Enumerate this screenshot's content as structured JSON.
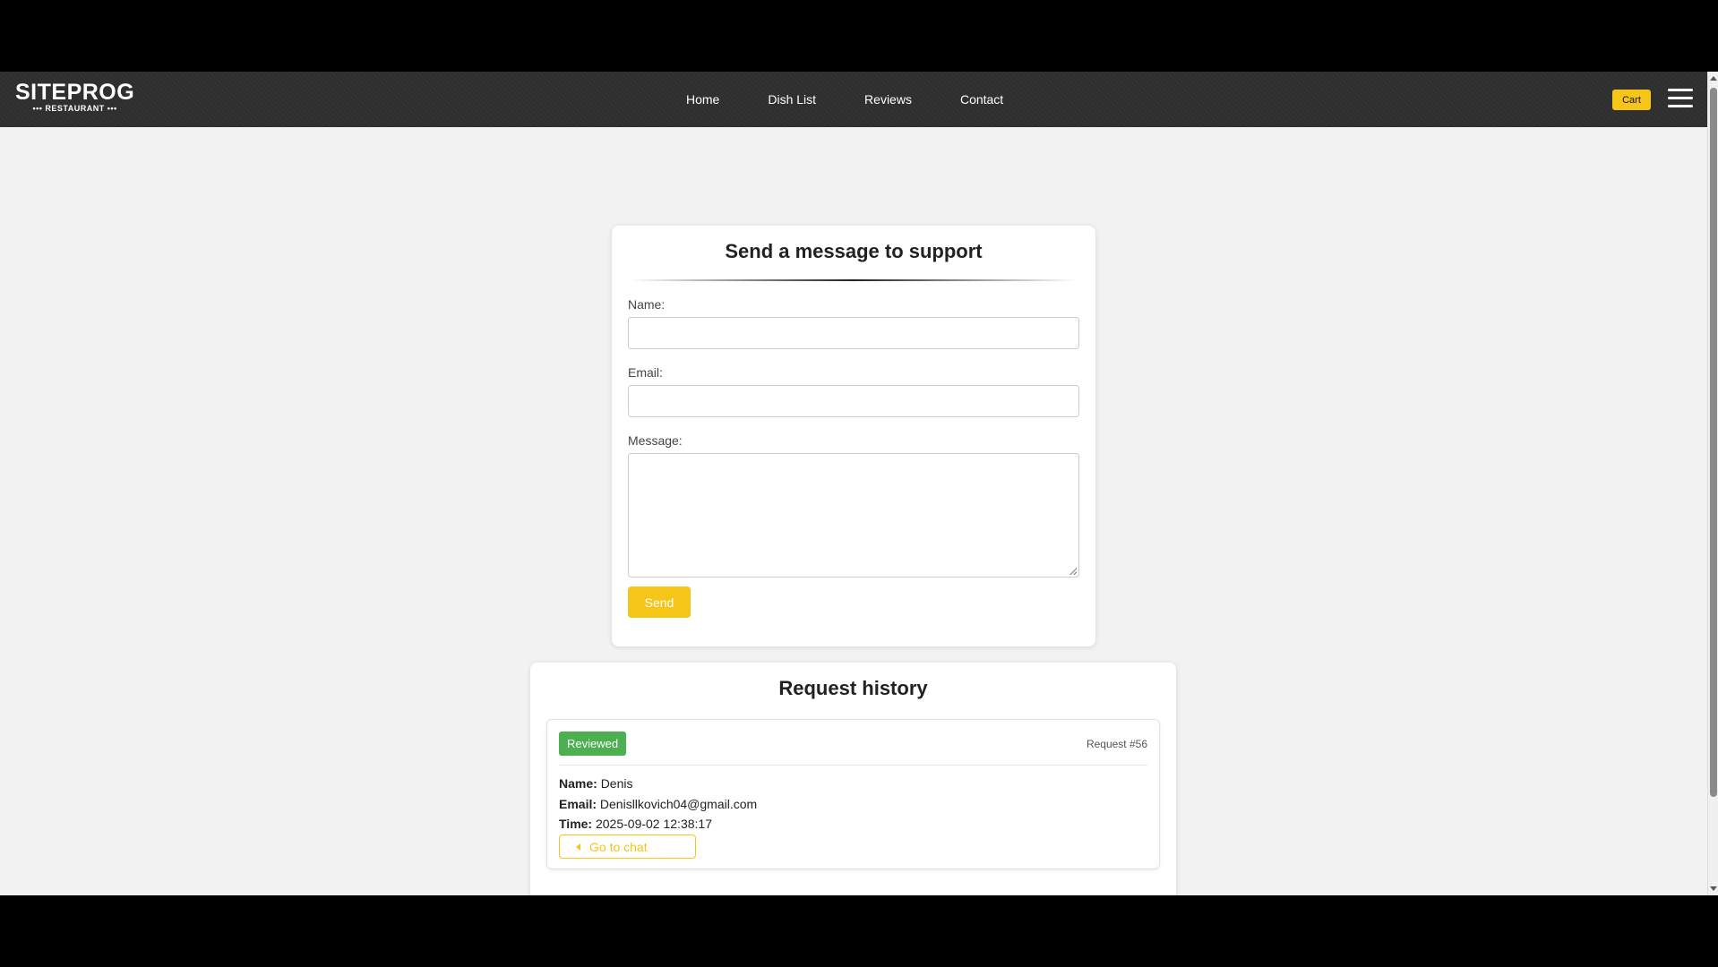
{
  "brand": {
    "name": "SITEPROG",
    "tagline": "••• RESTAURANT •••"
  },
  "nav": {
    "items": [
      "Home",
      "Dish List",
      "Reviews",
      "Contact"
    ]
  },
  "header": {
    "cart_label": "Cart"
  },
  "support_form": {
    "title": "Send a message to support",
    "name_label": "Name:",
    "name_value": "",
    "email_label": "Email:",
    "email_value": "",
    "message_label": "Message:",
    "message_value": "",
    "send_label": "Send"
  },
  "history": {
    "title": "Request history",
    "requests": [
      {
        "status": "Reviewed",
        "id_label": "Request #56",
        "name_label": "Name:",
        "name": "Denis",
        "email_label": "Email:",
        "email": "Denisllkovich04@gmail.com",
        "time_label": "Time:",
        "time": "2025-09-02 12:38:17",
        "chat_label": "Go to chat"
      }
    ]
  },
  "colors": {
    "accent": "#f5c518",
    "status_reviewed": "#4caf50",
    "navbar": "#2f2f2f",
    "page_bg": "#f2f2f2"
  },
  "icons": {
    "menu": "hamburger-icon",
    "chat": "caret-left-icon"
  }
}
